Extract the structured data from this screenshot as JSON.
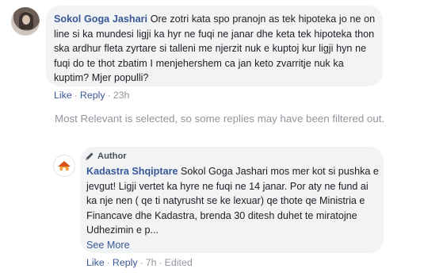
{
  "comment": {
    "author": "Sokol Goga Jashari",
    "text": "Ore zotri kata spo pranojn as tek hipoteka jo ne on line si ka mundesi ligji ka hyr ne fuqi ne janar dhe keta tek hipoteka thon ska ardhur fleta zyrtare si talleni me njerzit nuk e kuptoj kur ligji hyn ne fuqi do te thot zbatim I menjehershem ca jan keto zvarritje nuk ka kuptim? Mjer populli?",
    "actions": {
      "like": "Like",
      "reply": "Reply",
      "time": "23h"
    }
  },
  "filter_note": "Most Relevant is selected, so some replies may have been filtered out.",
  "reply": {
    "badge": "Author",
    "author": "Kadastra Shqiptare",
    "text": "Sokol Goga Jashari mos mer kot si pushka e jevgut! Ligji vertet ka hyre ne fuqi ne 14 janar. Por aty ne fund ai ka nje nen ( qe ti natyrusht se ke lexuar) qe thote qe Ministria e Financave dhe Kadastra, brenda 30 ditesh duhet te miratojne Udhezimin e p...",
    "see_more": "See More",
    "actions": {
      "like": "Like",
      "reply": "Reply",
      "time": "7h",
      "edited": "Edited"
    }
  },
  "colors": {
    "link": "#385898",
    "bubble": "#f2f3f5",
    "muted": "#90949c"
  }
}
